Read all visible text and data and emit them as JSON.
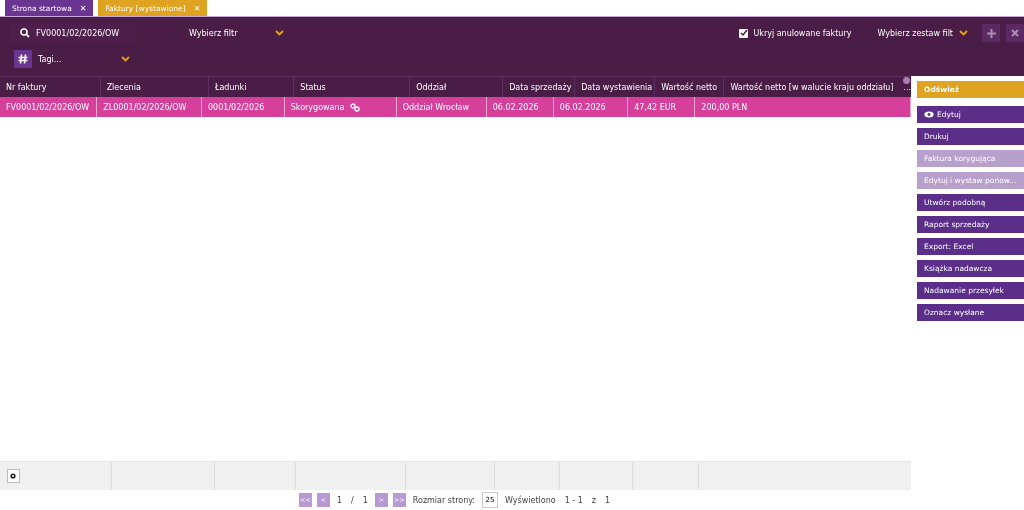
{
  "tabs": [
    {
      "label": "Strona startowa",
      "close": "✕",
      "selected": false
    },
    {
      "label": "Faktury [wystawione]",
      "close": "✕",
      "selected": true
    }
  ],
  "filters": {
    "search": "FV0001/02/2026/OW",
    "filter_select": "Wybierz filtr",
    "tags_placeholder": "Tagi...",
    "hide_cancelled": {
      "label": "Ukryj anulowane faktury",
      "checked": true
    },
    "filter_set": "Wybierz zestaw filt"
  },
  "table": {
    "columns": [
      "Nr faktury",
      "Zlecenia",
      "Ładunki",
      "Status",
      "Oddział",
      "Data sprzedaży",
      "Data wystawienia",
      "Wartość netto",
      "Wartość netto [w walucie kraju oddziału]"
    ],
    "more": "...",
    "rows": [
      {
        "selected": true,
        "cells": [
          "FV0001/02/2026/OW",
          "ZL0001/02/2026/OW",
          "0001/02/2026",
          "Skorygowana",
          "Oddział Wrocław",
          "06.02.2026",
          "06.02.2026",
          "47,42 EUR",
          "200,00 PLN"
        ]
      }
    ]
  },
  "actions": [
    {
      "label": "Odśwież",
      "kind": "refresh",
      "disabled": false
    },
    {
      "label": "Edytuj",
      "kind": "view",
      "disabled": false
    },
    {
      "label": "Drukuj",
      "kind": "action",
      "disabled": false
    },
    {
      "label": "Faktura korygująca",
      "kind": "action",
      "disabled": true
    },
    {
      "label": "Edytuj i wystaw ponow...",
      "kind": "action",
      "disabled": true
    },
    {
      "label": "Utwórz podobną",
      "kind": "action",
      "disabled": false
    },
    {
      "label": "Raport sprzedaży",
      "kind": "action",
      "disabled": false
    },
    {
      "label": "Export: Excel",
      "kind": "action",
      "disabled": false
    },
    {
      "label": "Książka nadawcza",
      "kind": "action",
      "disabled": false
    },
    {
      "label": "Nadawanie przesyłek",
      "kind": "action",
      "disabled": false
    },
    {
      "label": "Oznacz wysłane",
      "kind": "action",
      "disabled": false
    }
  ],
  "pager": {
    "first": "<<",
    "prev": "<",
    "page": "1",
    "sep": "/",
    "total": "1",
    "next": ">",
    "last": ">>",
    "size_label": "Rozmiar strony:",
    "size": "25",
    "shown": "Wyświetlono",
    "range": "1 - 1",
    "of": "z",
    "count": "1"
  }
}
